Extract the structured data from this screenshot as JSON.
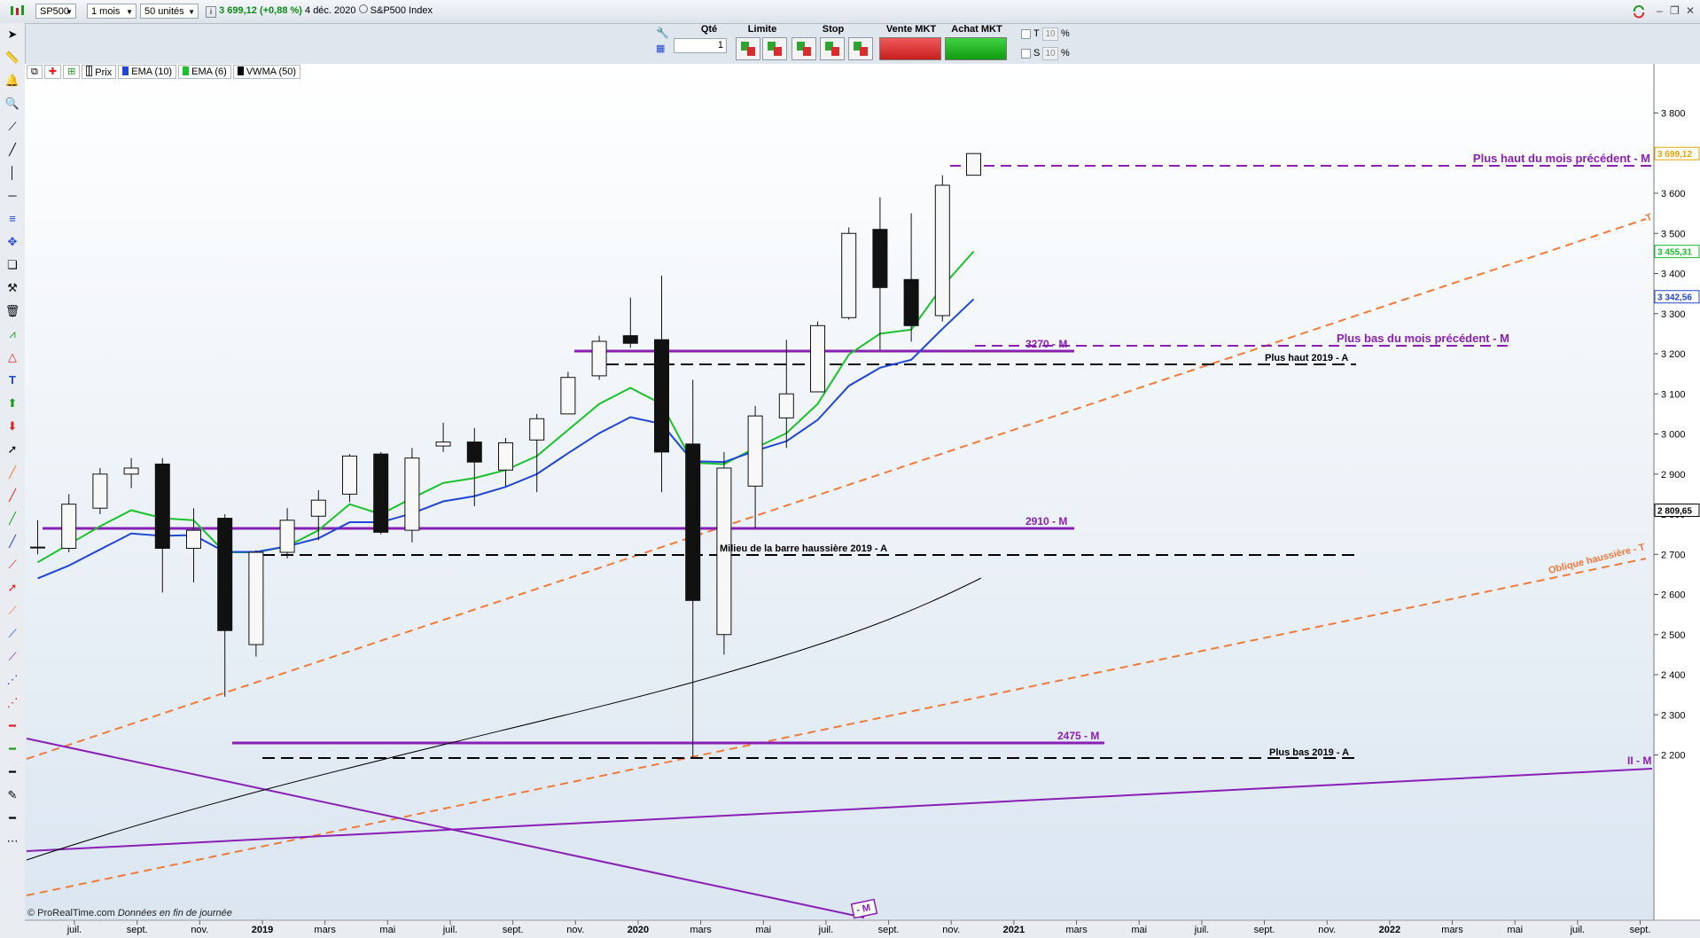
{
  "toolbar": {
    "symbol": "SP500",
    "period": "1 mois",
    "units": "50 unités",
    "price": "3 699,12",
    "change": "(+0,88 %)",
    "date": "4 déc. 2020",
    "index_name": "S&P500 Index"
  },
  "order_panel": {
    "qty_label": "Qté",
    "qty_value": "1",
    "limit_label": "Limite",
    "stop_label": "Stop",
    "sell_label": "Vente MKT",
    "buy_label": "Achat MKT",
    "t_label": "T",
    "s_label": "S",
    "t_value": "10",
    "s_value": "10",
    "pct": "%"
  },
  "legend": {
    "price": "Prix",
    "ema10": "EMA (10)",
    "ema6": "EMA (6)",
    "vwma": "VWMA (50)"
  },
  "colors": {
    "ema10": "#1f46d6",
    "ema6": "#19c22d",
    "vwma": "#000000",
    "level": "#8a1fb5",
    "trend": "#f07a3a"
  },
  "chart_data": {
    "type": "candlestick",
    "series_name": "S&P500 Index",
    "interval": "1 mois",
    "y_ticks": [
      2200,
      2300,
      2400,
      2500,
      2600,
      2700,
      2800,
      2900,
      3000,
      3100,
      3200,
      3300,
      3400,
      3500,
      3600,
      3700,
      3800
    ],
    "y_tick_labels": [
      "2 200",
      "2 300",
      "2 400",
      "2 500",
      "2 600",
      "2 700",
      "2 800",
      "2 900",
      "3 000",
      "3 100",
      "3 200",
      "3 300",
      "3 400",
      "3 500",
      "3 600",
      "3 700",
      "3 800"
    ],
    "x_labels": [
      "juil.",
      "sept.",
      "nov.",
      "2019",
      "mars",
      "mai",
      "juil.",
      "sept.",
      "nov.",
      "2020",
      "mars",
      "mai",
      "juil.",
      "sept.",
      "nov.",
      "2021",
      "mars",
      "mai",
      "juil.",
      "sept.",
      "nov.",
      "2022",
      "mars",
      "mai",
      "juil.",
      "sept."
    ],
    "ohlc": [
      {
        "o": 2718,
        "h": 2785,
        "l": 2700,
        "c": 2718
      },
      {
        "o": 2715,
        "h": 2850,
        "l": 2705,
        "c": 2825
      },
      {
        "o": 2815,
        "h": 2915,
        "l": 2800,
        "c": 2900
      },
      {
        "o": 2900,
        "h": 2940,
        "l": 2865,
        "c": 2915
      },
      {
        "o": 2925,
        "h": 2940,
        "l": 2605,
        "c": 2715
      },
      {
        "o": 2715,
        "h": 2815,
        "l": 2630,
        "c": 2760
      },
      {
        "o": 2790,
        "h": 2800,
        "l": 2345,
        "c": 2510
      },
      {
        "o": 2475,
        "h": 2710,
        "l": 2445,
        "c": 2705
      },
      {
        "o": 2705,
        "h": 2815,
        "l": 2690,
        "c": 2785
      },
      {
        "o": 2795,
        "h": 2860,
        "l": 2735,
        "c": 2835
      },
      {
        "o": 2850,
        "h": 2950,
        "l": 2830,
        "c": 2945
      },
      {
        "o": 2950,
        "h": 2955,
        "l": 2750,
        "c": 2755
      },
      {
        "o": 2760,
        "h": 2965,
        "l": 2730,
        "c": 2940
      },
      {
        "o": 2970,
        "h": 3028,
        "l": 2955,
        "c": 2980
      },
      {
        "o": 2980,
        "h": 3015,
        "l": 2820,
        "c": 2930
      },
      {
        "o": 2910,
        "h": 2990,
        "l": 2870,
        "c": 2978
      },
      {
        "o": 2985,
        "h": 3050,
        "l": 2855,
        "c": 3038
      },
      {
        "o": 3050,
        "h": 3155,
        "l": 3050,
        "c": 3141
      },
      {
        "o": 3145,
        "h": 3245,
        "l": 3135,
        "c": 3231
      },
      {
        "o": 3245,
        "h": 3340,
        "l": 3215,
        "c": 3226
      },
      {
        "o": 3235,
        "h": 3395,
        "l": 2855,
        "c": 2955
      },
      {
        "o": 2975,
        "h": 3135,
        "l": 2190,
        "c": 2585
      },
      {
        "o": 2500,
        "h": 2955,
        "l": 2450,
        "c": 2915
      },
      {
        "o": 2870,
        "h": 3070,
        "l": 2765,
        "c": 3045
      },
      {
        "o": 3040,
        "h": 3235,
        "l": 2965,
        "c": 3100
      },
      {
        "o": 3105,
        "h": 3280,
        "l": 3105,
        "c": 3270
      },
      {
        "o": 3290,
        "h": 3515,
        "l": 3285,
        "c": 3500
      },
      {
        "o": 3510,
        "h": 3590,
        "l": 3210,
        "c": 3365
      },
      {
        "o": 3385,
        "h": 3550,
        "l": 3230,
        "c": 3270
      },
      {
        "o": 3295,
        "h": 3645,
        "l": 3280,
        "c": 3620
      },
      {
        "o": 3645,
        "h": 3700,
        "l": 3645,
        "c": 3699
      }
    ],
    "ema10": [
      2640,
      2672,
      2712,
      2752,
      2746,
      2748,
      2706,
      2706,
      2720,
      2740,
      2780,
      2780,
      2802,
      2832,
      2845,
      2868,
      2900,
      2952,
      3002,
      3042,
      3025,
      2932,
      2930,
      2958,
      2982,
      3035,
      3120,
      3165,
      3185,
      3262,
      3336
    ],
    "ema6": [
      2680,
      2725,
      2770,
      2810,
      2790,
      2785,
      2705,
      2705,
      2720,
      2760,
      2825,
      2800,
      2840,
      2878,
      2890,
      2910,
      2945,
      3010,
      3075,
      3115,
      3075,
      2928,
      2925,
      2965,
      3002,
      3075,
      3198,
      3250,
      3260,
      3368,
      3455
    ],
    "vwma50_end": 2810,
    "price_labels": [
      {
        "text": "3 699,12",
        "value": 3699,
        "color": "#e8a400"
      },
      {
        "text": "3 455,31",
        "value": 3455,
        "color": "#19c22d"
      },
      {
        "text": "3 342,56",
        "value": 3342,
        "color": "#1f46d6"
      },
      {
        "text": "2 809,65",
        "value": 2810,
        "color": "#000000"
      }
    ],
    "annotations": {
      "prev_month_high": "Plus haut du mois précédent - M",
      "prev_month_low": "Plus bas du mois précédent - M",
      "level_3270": "3270 - M",
      "high_2019": "Plus haut 2019 - A",
      "level_2910": "2910 - M",
      "mid_bar_2019": "Milieu de la barre haussière 2019 - A",
      "level_2475": "2475 - M",
      "low_2019": "Plus bas 2019 - A",
      "oblique": "Oblique haussière - T",
      "trend_t": "- T",
      "ii_m": "II - M",
      "m_tag": "- M"
    }
  },
  "footer": {
    "copyright": "© ProRealTime.com",
    "data_note": "Données en fin de journée"
  }
}
